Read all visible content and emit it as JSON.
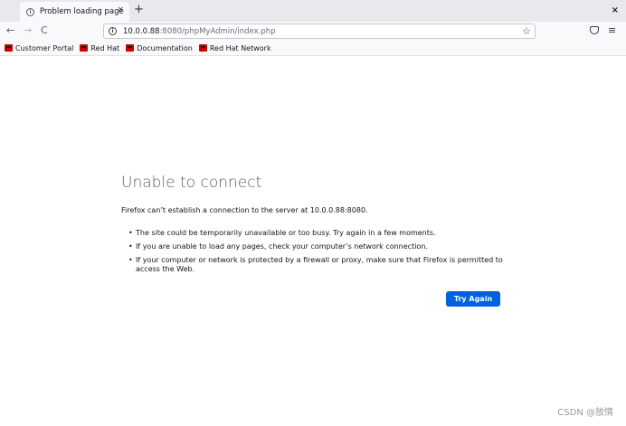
{
  "tabs": [
    {
      "title": "Problem loading page",
      "close": "×"
    }
  ],
  "newtab_label": "+",
  "window_close": "×",
  "nav": {
    "back": "←",
    "forward": "→",
    "reload": "C"
  },
  "url": {
    "host": "10.0.0.88",
    "rest": ":8080/phpMyAdmin/index.php",
    "star": "☆"
  },
  "menu_icon": "≡",
  "bookmarks": [
    {
      "label": "Customer Portal"
    },
    {
      "label": "Red Hat"
    },
    {
      "label": "Documentation"
    },
    {
      "label": "Red Hat Network"
    }
  ],
  "error": {
    "title": "Unable to connect",
    "description": "Firefox can’t establish a connection to the server at 10.0.0.88:8080.",
    "items": [
      "The site could be temporarily unavailable or too busy. Try again in a few moments.",
      "If you are unable to load any pages, check your computer’s network connection.",
      "If your computer or network is protected by a firewall or proxy, make sure that Firefox is permitted to access the Web."
    ],
    "button": "Try Again"
  },
  "watermark": "CSDN @放情",
  "colors": {
    "accent": "#0061e0",
    "tabbar": "#e8e8ed",
    "toolbar": "#f9f9fb"
  }
}
